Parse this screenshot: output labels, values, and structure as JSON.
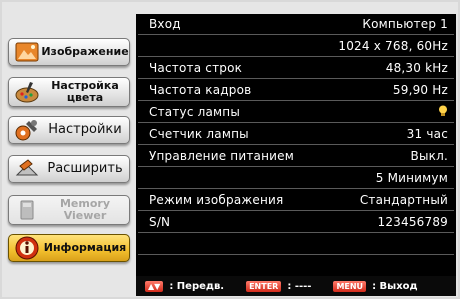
{
  "menu": [
    {
      "id": "image",
      "label": "Изображение",
      "icon": "image-icon",
      "active": false,
      "disabled": false,
      "big": false
    },
    {
      "id": "color",
      "label": "Настройка\nцвета",
      "icon": "palette-icon",
      "active": false,
      "disabled": false,
      "big": false
    },
    {
      "id": "settings",
      "label": "Настройки",
      "icon": "gear-icon",
      "active": false,
      "disabled": false,
      "big": true
    },
    {
      "id": "expand",
      "label": "Расширить",
      "icon": "expand-icon",
      "active": false,
      "disabled": false,
      "big": true
    },
    {
      "id": "memory",
      "label": "Memory\nViewer",
      "icon": "memory-card-icon",
      "active": false,
      "disabled": true,
      "big": false
    },
    {
      "id": "info",
      "label": "Информация",
      "icon": "info-icon",
      "active": true,
      "disabled": false,
      "big": false
    }
  ],
  "info_rows": [
    {
      "label": "Вход",
      "value": "Компьютер 1"
    },
    {
      "label": "",
      "value": "1024 x 768, 60Hz"
    },
    {
      "label": "Частота строк",
      "value": "48,30 kHz"
    },
    {
      "label": "Частота кадров",
      "value": "59,90 Hz"
    },
    {
      "label": "Статус лампы",
      "value": "",
      "icon": "lamp-icon"
    },
    {
      "label": "Счетчик лампы",
      "value": "31 час"
    },
    {
      "label": "Управление питанием",
      "value": "Выкл."
    },
    {
      "label": "",
      "value": "5 Минимум"
    },
    {
      "label": "Режим изображения",
      "value": "Стандартный"
    },
    {
      "label": "S/N",
      "value": "123456789"
    },
    {
      "label": "",
      "value": ""
    }
  ],
  "bottom_bar": {
    "nav_key": "▲▼",
    "nav_label": ": Передв.",
    "enter_key": "ENTER",
    "enter_label": ": ----",
    "menu_key": "MENU",
    "menu_label": ": Выход"
  },
  "colors": {
    "accent": "#f2bf2e",
    "panel_bg": "#000000",
    "key_red": "#d22a1a",
    "lamp": "#ffd34a"
  }
}
